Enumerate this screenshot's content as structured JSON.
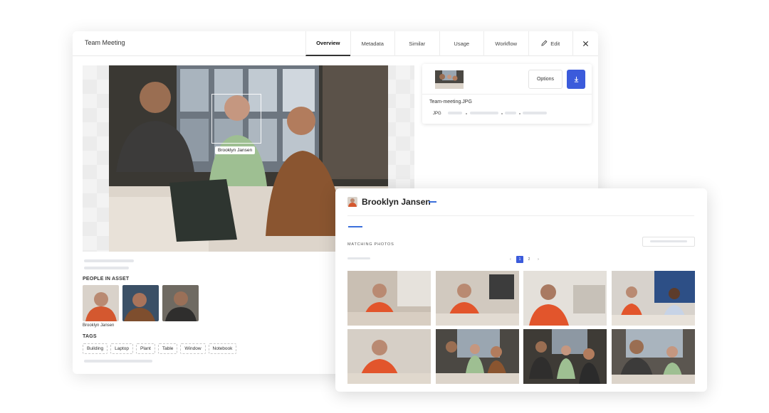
{
  "window": {
    "title": "Team Meeting"
  },
  "tabs": [
    {
      "label": "Overview"
    },
    {
      "label": "Metadata"
    },
    {
      "label": "Similar"
    },
    {
      "label": "Usage"
    },
    {
      "label": "Workflow"
    },
    {
      "label": "Edit",
      "icon": "pencil-icon"
    }
  ],
  "close_icon": "close-icon",
  "asset": {
    "face_tag": "Brooklyn Jansen",
    "people_title": "PEOPLE IN ASSET",
    "people_first_name": "Brooklyn Jansen",
    "tags_title": "TAGS",
    "tags": [
      "Building",
      "Laptop",
      "Plant",
      "Table",
      "Window",
      "Notebook"
    ]
  },
  "file": {
    "options_label": "Options",
    "download_icon": "download-icon",
    "filename": "Team-meeting.JPG",
    "type": "JPG"
  },
  "person": {
    "name": "Brooklyn Jansen",
    "matching_label": "MATCHING PHOTOS",
    "pages": [
      "1",
      "2"
    ],
    "current_page": "1"
  },
  "colors": {
    "accent": "#3b5bdb",
    "accent_line": "#3b6fdb"
  }
}
